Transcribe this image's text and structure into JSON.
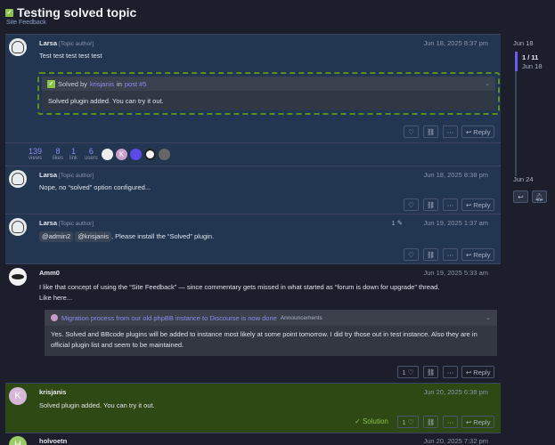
{
  "topic": {
    "title": "Testing solved topic",
    "category": "Site Feedback"
  },
  "posts": [
    {
      "username": "Larsa",
      "role": "[Topic author]",
      "date": "Jun 18, 2025 8:37 pm",
      "text": "Test test test test test",
      "quote": {
        "prefix": "Solved by",
        "user": "krisjanis",
        "in": "in",
        "post": "post #5",
        "body": "Solved plugin added. You can try it out."
      }
    },
    {
      "username": "Larsa",
      "role": "[Topic author]",
      "date": "Jun 18, 2025 8:38 pm",
      "text": "Nope, no “solved” option configured..."
    },
    {
      "username": "Larsa",
      "role": "[Topic author]",
      "date": "Jun 19, 2025 1:37 am",
      "edits": "1",
      "mention1": "@admin2",
      "mention2": "@krisjanis",
      "text": ", Please install the “Solved” plugin."
    },
    {
      "username": "Amm0",
      "date": "Jun 19, 2025 5:33 am",
      "text": "I like that concept of using the “Site Feedback” — since commentary gets missed in what started as “forum is down for upgrade” thread.",
      "text2": "Like here...",
      "embed": {
        "title": "Migration process from our old phpBB instance to Discourse is now done",
        "category": "Announcements",
        "body": "Yes. Solved and BBcode plugins will be added to instance most likely at some point tomorrow. I did try those out in test instance. Also they are in official plugin list and seem to be maintained."
      },
      "likes": "1"
    },
    {
      "username": "krisjanis",
      "avatar_letter": "K",
      "date": "Jun 20, 2025 6:38 pm",
      "text": "Solved plugin added. You can try it out.",
      "solution": "Solution",
      "likes": "1"
    },
    {
      "username": "holvoetn",
      "avatar_letter": "H",
      "date": "Jun 20, 2025 7:32 pm"
    }
  ],
  "stats": [
    {
      "num": "139",
      "label": "views"
    },
    {
      "num": "8",
      "label": "likes"
    },
    {
      "num": "1",
      "label": "link"
    },
    {
      "num": "6",
      "label": "users"
    }
  ],
  "stats_avatar_letter": "K",
  "actions": {
    "reply": "Reply"
  },
  "timeline": {
    "start": "Jun 18",
    "position": "1 / 11",
    "position_date": "Jun 18",
    "end": "Jun 24"
  },
  "colors": {
    "accent": "#6a5cf0",
    "solved": "#8bc34a",
    "post_bg": "#233651",
    "solution_bg": "#2e4914"
  }
}
